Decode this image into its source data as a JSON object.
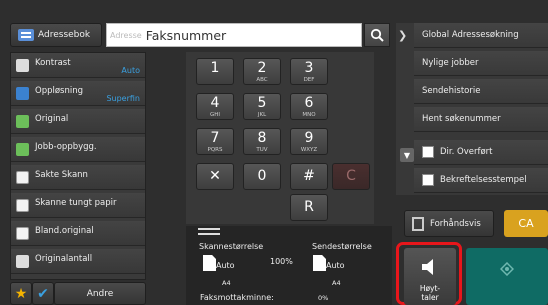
{
  "topbar": {
    "address_book_label": "Adressebok",
    "input_placeholder": "Adresse",
    "input_title": "Faksnummer"
  },
  "left_menu": [
    {
      "label": "Kontrast",
      "value": "Auto",
      "icon": "contrast-icon"
    },
    {
      "label": "Oppløsning",
      "value": "Superfin",
      "icon": "resolution-icon"
    },
    {
      "label": "Original",
      "value": "",
      "icon": "original-icon"
    },
    {
      "label": "Jobb-oppbygg.",
      "value": "",
      "icon": "job-build-icon"
    },
    {
      "label": "Sakte Skann",
      "value": "",
      "icon": "slow-scan-icon"
    },
    {
      "label": "Skanne tungt papir",
      "value": "",
      "icon": "heavy-paper-icon"
    },
    {
      "label": "Bland.original",
      "value": "",
      "icon": "mixed-original-icon"
    },
    {
      "label": "Originalantall",
      "value": "",
      "icon": "original-count-icon"
    }
  ],
  "bottom_left": {
    "other_label": "Andre"
  },
  "keypad": [
    {
      "num": "1",
      "sub": ""
    },
    {
      "num": "2",
      "sub": "ABC"
    },
    {
      "num": "3",
      "sub": "DEF"
    },
    {
      "num": "4",
      "sub": "GHI"
    },
    {
      "num": "5",
      "sub": "JKL"
    },
    {
      "num": "6",
      "sub": "MNO"
    },
    {
      "num": "7",
      "sub": "PQRS"
    },
    {
      "num": "8",
      "sub": "TUV"
    },
    {
      "num": "9",
      "sub": "WXYZ"
    },
    {
      "num": "✕",
      "sub": ""
    },
    {
      "num": "0",
      "sub": ""
    },
    {
      "num": "#",
      "sub": ""
    },
    {
      "num": "C",
      "sub": ""
    },
    {
      "num": "R",
      "sub": ""
    }
  ],
  "settings": {
    "scan_size_label": "Skannestørrelse",
    "send_size_label": "Sendestørrelse",
    "scan_mode": "Auto",
    "send_mode": "Auto",
    "scan_paper": "A4",
    "send_paper": "A4",
    "ratio": "100%",
    "fax_receive_label": "Faksmottakminne:",
    "fax_receive_value": "0%"
  },
  "right_menu": [
    {
      "label": "Global Adressesøkning"
    },
    {
      "label": "Nylige jobber"
    },
    {
      "label": "Sendehistorie"
    },
    {
      "label": "Hent søkenummer"
    },
    {
      "label": "Dir. Overført"
    },
    {
      "label": "Bekreftelsesstempel"
    }
  ],
  "right_buttons": {
    "preview_label": "Forhåndsvis",
    "ca_label": "CA",
    "speaker_label_1": "Høyt-",
    "speaker_label_2": "taler"
  },
  "colors": {
    "accent_blue": "#3aa0e0",
    "ca_gold": "#d9a21f",
    "start_teal": "#0f6b64",
    "highlight_red": "#e8161b"
  }
}
